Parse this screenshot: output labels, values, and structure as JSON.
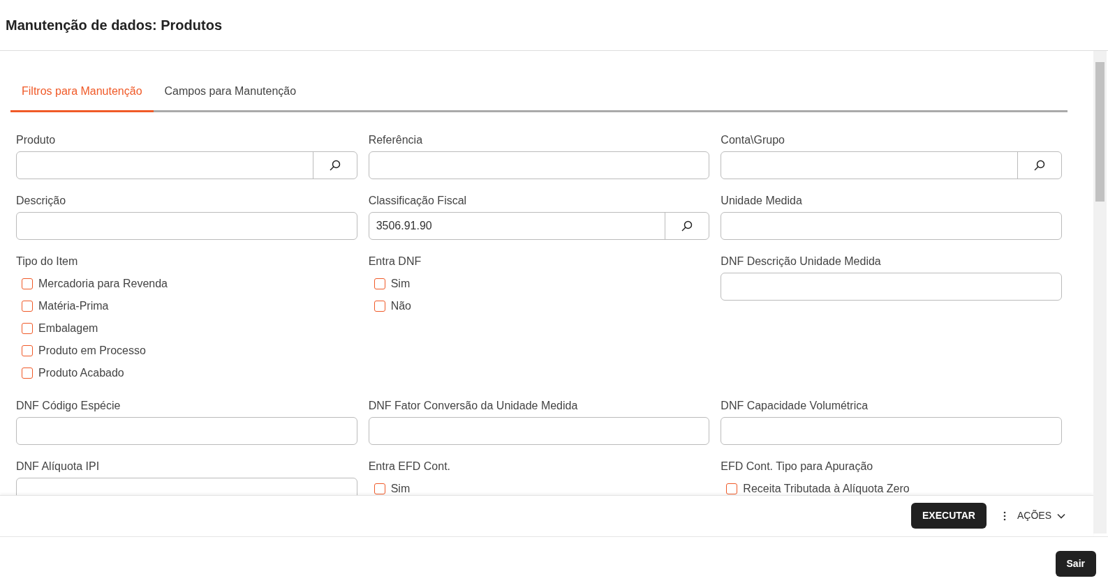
{
  "title": "Manutenção de dados: Produtos",
  "tabs": [
    {
      "label": "Filtros para Manutenção",
      "selected": true
    },
    {
      "label": "Campos para Manutenção",
      "selected": false
    }
  ],
  "fields": [
    {
      "kind": "lookup",
      "label": "Produto"
    },
    {
      "kind": "input",
      "label": "Referência"
    },
    {
      "kind": "lookup",
      "label": "Conta\\Grupo"
    },
    {
      "kind": "input",
      "label": "Descrição"
    },
    {
      "kind": "lookup",
      "label": "Classificação Fiscal",
      "value": "3506.91.90"
    },
    {
      "kind": "input",
      "label": "Unidade Medida"
    },
    {
      "kind": "checkboxes",
      "label": "Tipo do Item",
      "options": [
        {
          "label": "Mercadoria para Revenda",
          "checked": false
        },
        {
          "label": "Matéria-Prima",
          "checked": false
        },
        {
          "label": "Embalagem",
          "checked": false
        },
        {
          "label": "Produto em Processo",
          "checked": false
        },
        {
          "label": "Produto Acabado",
          "checked": false
        }
      ]
    },
    {
      "kind": "checkboxes",
      "label": "Entra DNF",
      "options": [
        {
          "label": "Sim",
          "checked": false
        },
        {
          "label": "Não",
          "checked": false
        }
      ]
    },
    {
      "kind": "input",
      "label": "DNF Descrição Unidade Medida"
    },
    {
      "kind": "input",
      "label": "DNF Código Espécie"
    },
    {
      "kind": "input",
      "label": "DNF Fator Conversão da Unidade Medida"
    },
    {
      "kind": "input",
      "label": "DNF Capacidade Volumétrica"
    },
    {
      "kind": "input",
      "label": "DNF Alíquota IPI"
    },
    {
      "kind": "checkboxes",
      "label": "Entra EFD Cont.",
      "options": [
        {
          "label": "Sim",
          "checked": false
        }
      ]
    },
    {
      "kind": "checkboxes",
      "label": "EFD Cont. Tipo para Apuração",
      "options": [
        {
          "label": "Receita Tributada à Alíquota Zero",
          "checked": false
        }
      ]
    }
  ],
  "execute": "EXECUTAR",
  "actions": "AÇÕES",
  "exit": "Sair"
}
